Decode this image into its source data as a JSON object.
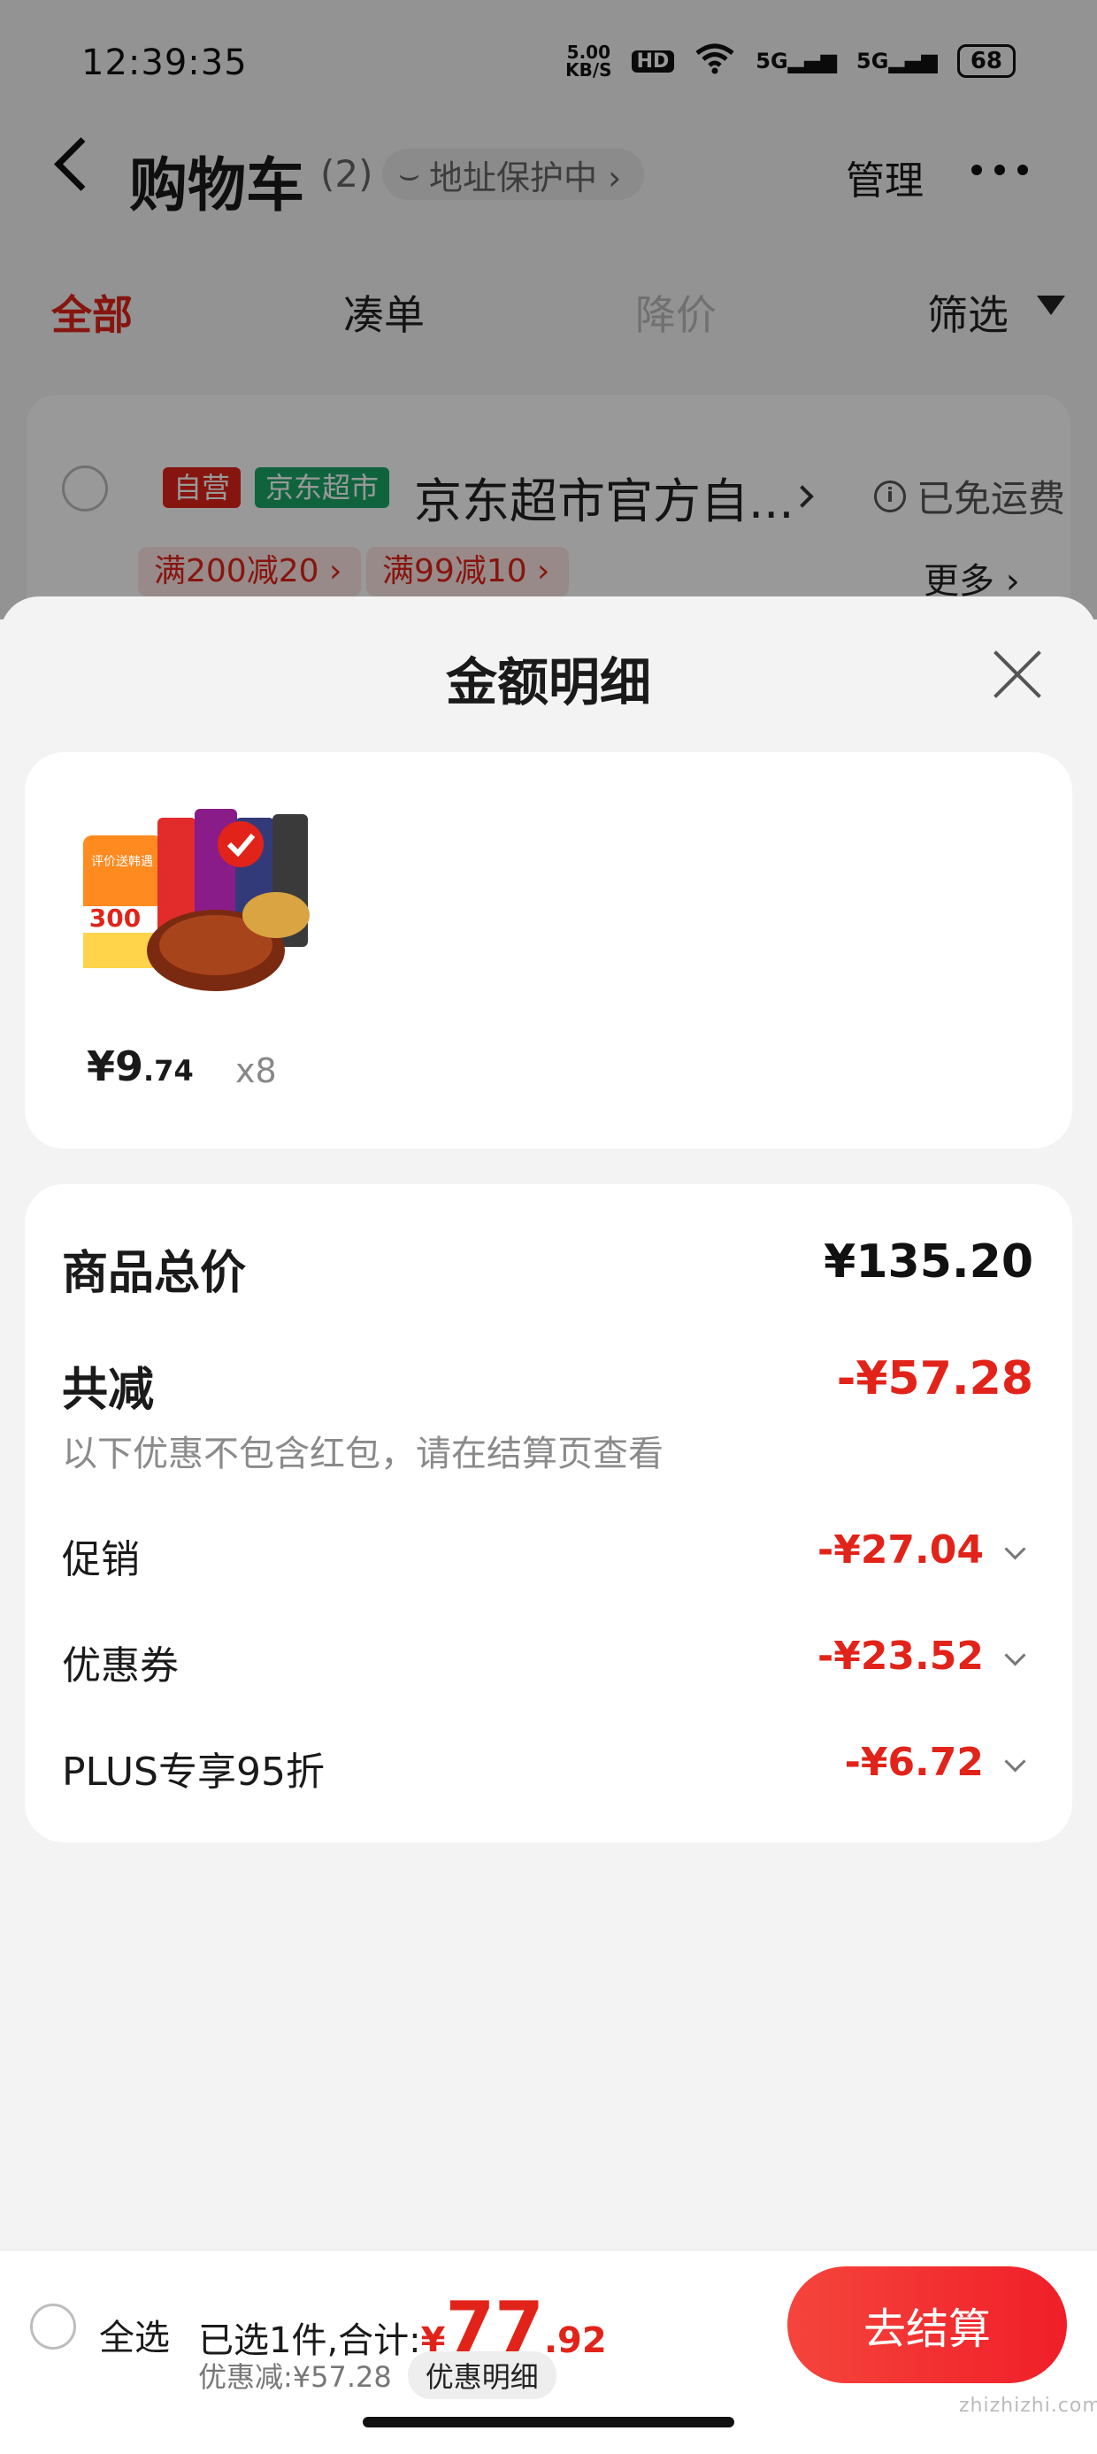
{
  "status_bar": {
    "time": "12:39:35",
    "net_speed_value": "5.00",
    "net_speed_unit": "KB/S",
    "hd_label": "HD",
    "signal_1": "5G",
    "signal_2": "5G",
    "battery": "68"
  },
  "header": {
    "title": "购物车",
    "count": "(2)",
    "address_protect": "地址保护中 ›",
    "manage": "管理"
  },
  "tabs": [
    {
      "label": "全部",
      "active": true
    },
    {
      "label": "凑单",
      "active": false
    },
    {
      "label": "降价",
      "active": false
    },
    {
      "label": "筛选",
      "active": false
    }
  ],
  "store": {
    "tag_ziying": "自营",
    "tag_market": "京东超市",
    "name": "京东超市官方自...",
    "shipping": "已免运费",
    "promos": [
      "满200减20 ›",
      "满99减10 ›"
    ],
    "more": "更多 ›"
  },
  "sheet": {
    "title": "金额明细",
    "product": {
      "price_int": "¥9",
      "price_dec": ".74",
      "qty": "x8",
      "image_text": "评价送韩遇",
      "image_number": "300"
    },
    "summary": {
      "total_label": "商品总价",
      "total_value": "¥135.20",
      "reduce_label": "共减",
      "reduce_value": "-¥57.28",
      "note": "以下优惠不包含红包，请在结算页查看",
      "lines": [
        {
          "label": "促销",
          "value": "-¥27.04"
        },
        {
          "label": "优惠券",
          "value": "-¥23.52"
        },
        {
          "label": "PLUS专享95折",
          "value": "-¥6.72"
        }
      ]
    }
  },
  "bottom_bar": {
    "select_all": "全选",
    "selected_text": "已选1件,合计:",
    "yen": "¥",
    "total_int": "77",
    "total_dec": ".92",
    "discount_text": "优惠减:¥57.28",
    "detail_label": "优惠明细",
    "checkout": "去结算",
    "watermark": "zhizhizhi.com"
  },
  "colors": {
    "accent_red": "#e2231a",
    "market_green": "#1aa768"
  }
}
